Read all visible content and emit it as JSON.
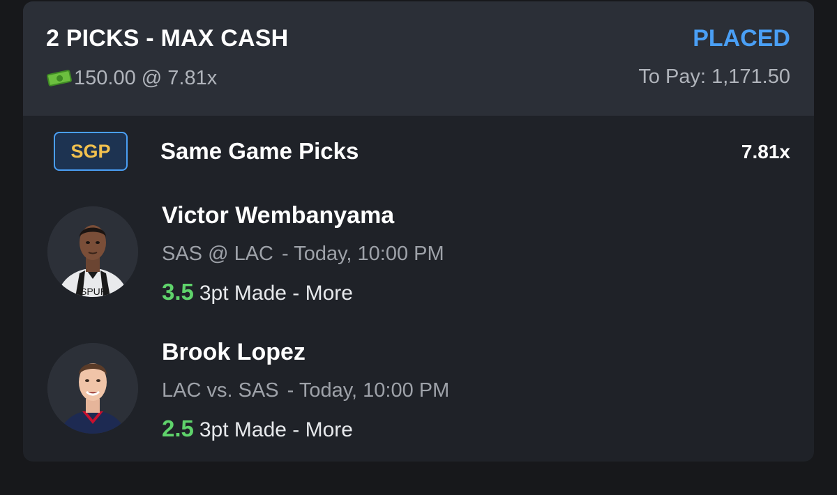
{
  "entry": {
    "title": "2 PICKS - MAX CASH",
    "status": "PLACED",
    "stake": "150.00 @ 7.81x",
    "to_pay": "To Pay: 1,171.50",
    "money_icon": "money-bill-icon"
  },
  "group": {
    "badge": "SGP",
    "title": "Same Game Picks",
    "multiplier": "7.81x"
  },
  "picks": [
    {
      "player": "Victor Wembanyama",
      "matchup": "SAS @ LAC",
      "time": "- Today, 10:00 PM",
      "line": "3.5",
      "stat": "3pt Made - More"
    },
    {
      "player": "Brook Lopez",
      "matchup": "LAC vs. SAS",
      "time": "- Today, 10:00 PM",
      "line": "2.5",
      "stat": "3pt Made - More"
    }
  ],
  "colors": {
    "background": "#17181b",
    "card": "#1f2228",
    "header": "#2b2f37",
    "status_blue": "#4a9ff5",
    "line_green": "#5fd36b",
    "badge_yellow": "#f2c14e"
  }
}
